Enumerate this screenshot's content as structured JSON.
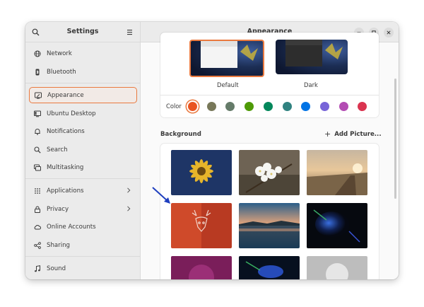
{
  "sidebar": {
    "title": "Settings",
    "items": [
      {
        "label": "Network",
        "icon": "network-icon"
      },
      {
        "label": "Bluetooth",
        "icon": "bluetooth-icon"
      },
      {
        "label": "Appearance",
        "icon": "appearance-icon",
        "active": true
      },
      {
        "label": "Ubuntu Desktop",
        "icon": "ubuntu-desktop-icon"
      },
      {
        "label": "Notifications",
        "icon": "bell-icon"
      },
      {
        "label": "Search",
        "icon": "search-icon"
      },
      {
        "label": "Multitasking",
        "icon": "multitasking-icon"
      },
      {
        "label": "Applications",
        "icon": "grid-icon",
        "chevron": true
      },
      {
        "label": "Privacy",
        "icon": "lock-icon",
        "chevron": true
      },
      {
        "label": "Online Accounts",
        "icon": "cloud-icon"
      },
      {
        "label": "Sharing",
        "icon": "share-icon"
      },
      {
        "label": "Sound",
        "icon": "music-note-icon"
      }
    ]
  },
  "main": {
    "title": "Appearance",
    "style": {
      "options": [
        {
          "label": "Default",
          "selected": true
        },
        {
          "label": "Dark",
          "selected": false
        }
      ]
    },
    "color": {
      "label": "Color",
      "swatches": [
        "#e95420",
        "#787859",
        "#657b69",
        "#4e9a06",
        "#03875b",
        "#308280",
        "#0073e5",
        "#7764d8",
        "#b34cb3",
        "#da3450"
      ],
      "selected_index": 0
    },
    "background": {
      "label": "Background",
      "add_label": "Add Picture..."
    }
  },
  "colors": {
    "accent": "#e9793f",
    "annotation_arrow": "#1f3fbf"
  }
}
